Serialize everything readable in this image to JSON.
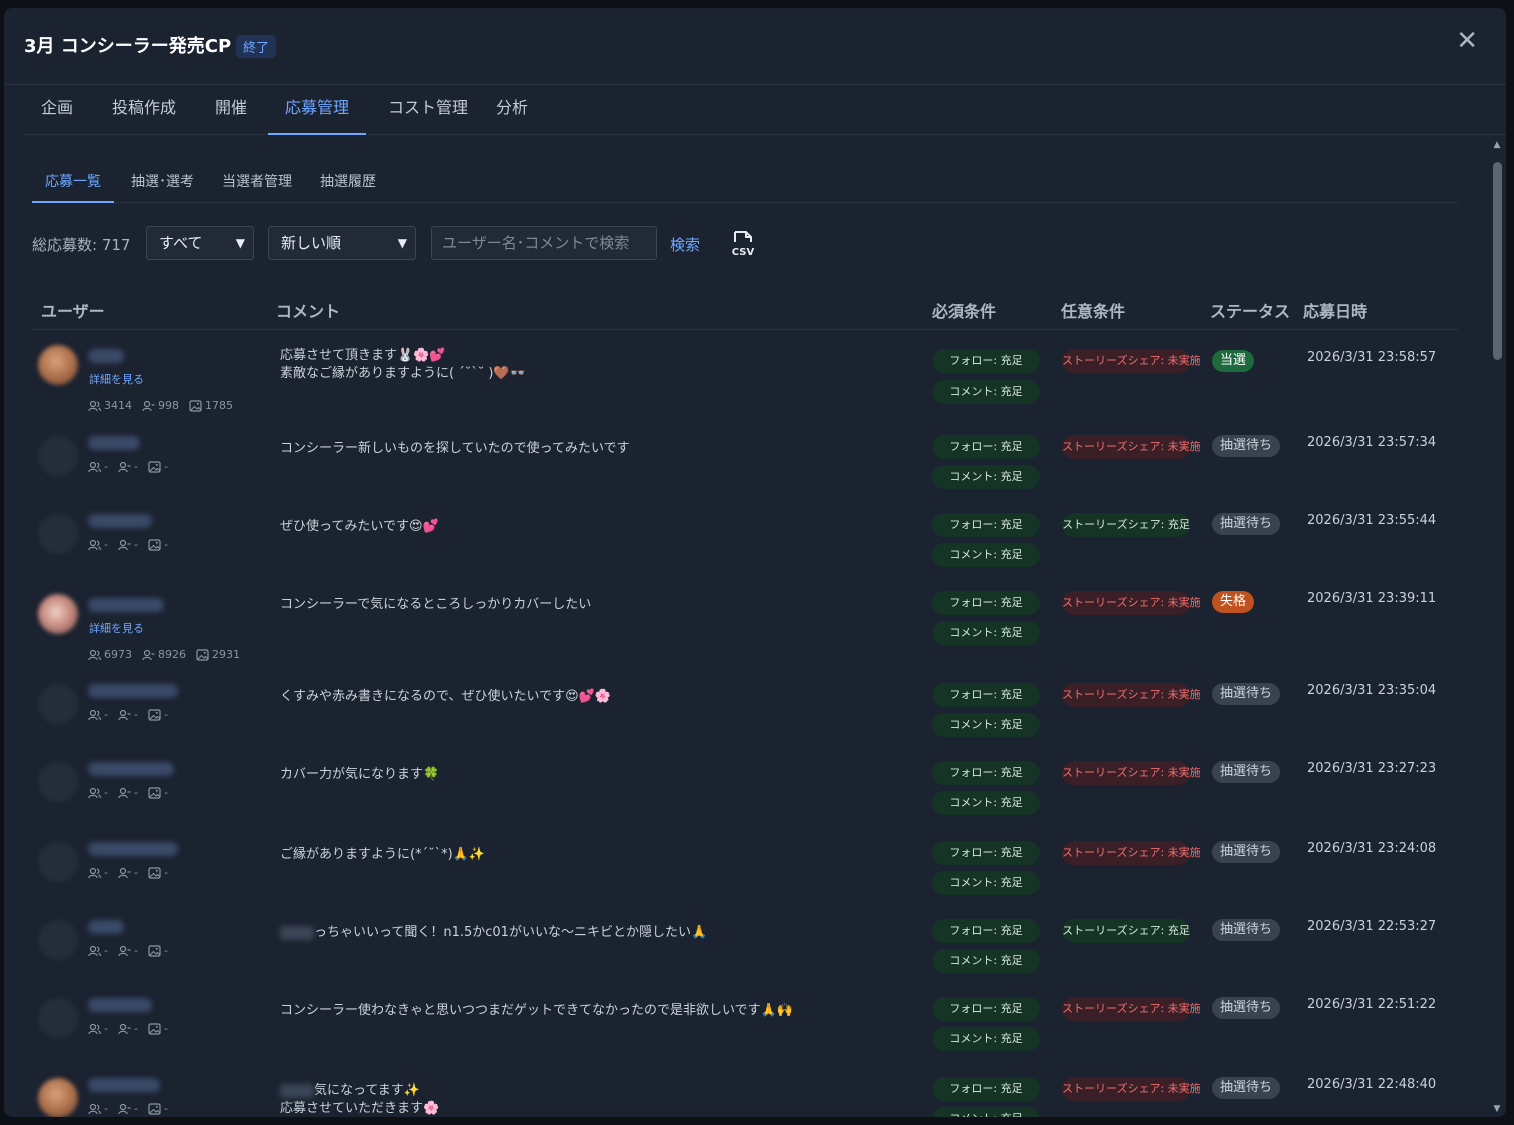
{
  "header": {
    "title": "3月 コンシーラー発売CP",
    "badge": "終了",
    "close": "✕"
  },
  "tabs": [
    "企画",
    "投稿作成",
    "開催",
    "応募管理",
    "コスト管理",
    "分析"
  ],
  "subtabs": [
    "応募一覧",
    "抽選･選考",
    "当選者管理",
    "抽選履歴"
  ],
  "toolbar": {
    "total": "総応募数: 717",
    "filter": "すべて",
    "sort": "新しい順",
    "search_placeholder": "ユーザー名･コメントで検索",
    "search_button": "検索",
    "csv_label": "CSV"
  },
  "columns": [
    "ユーザー",
    "コメント",
    "必須条件",
    "任意条件",
    "ステータス",
    "応募日時"
  ],
  "labels": {
    "detail": "詳細を見る",
    "dash": "-"
  },
  "rows": [
    {
      "stats": [
        "3414",
        "998",
        "1785"
      ],
      "comment": [
        "応募させて頂きます🐰🌸💕",
        "素敵なご縁がありますように( ´˘`˘ )🤎👓"
      ],
      "req": [
        "フォロー: 充足",
        "コメント: 充足"
      ],
      "opt": "ストーリーズシェア: 未実施",
      "status": "当選",
      "date": "2026/3/31 23:58:57"
    },
    {
      "stats": null,
      "comment": [
        "コンシーラー新しいものを探していたので使ってみたいです"
      ],
      "req": [
        "フォロー: 充足",
        "コメント: 充足"
      ],
      "opt": "ストーリーズシェア: 未実施",
      "status": "抽選待ち",
      "date": "2026/3/31 23:57:34"
    },
    {
      "stats": null,
      "comment": [
        "ぜひ使ってみたいです😍💕"
      ],
      "req": [
        "フォロー: 充足",
        "コメント: 充足"
      ],
      "opt": "ストーリーズシェア: 充足",
      "status": "抽選待ち",
      "date": "2026/3/31 23:55:44"
    },
    {
      "stats": [
        "6973",
        "8926",
        "2931"
      ],
      "comment": [
        "コンシーラーで気になるところしっかりカバーしたい"
      ],
      "req": [
        "フォロー: 充足",
        "コメント: 充足"
      ],
      "opt": "ストーリーズシェア: 未実施",
      "status": "失格",
      "date": "2026/3/31 23:39:11"
    },
    {
      "stats": null,
      "comment": [
        "くすみや赤み書きになるので、ぜひ使いたいです😍💕🌸"
      ],
      "req": [
        "フォロー: 充足",
        "コメント: 充足"
      ],
      "opt": "ストーリーズシェア: 未実施",
      "status": "抽選待ち",
      "date": "2026/3/31 23:35:04"
    },
    {
      "stats": null,
      "comment": [
        "カバー力が気になります🍀"
      ],
      "req": [
        "フォロー: 充足",
        "コメント: 充足"
      ],
      "opt": "ストーリーズシェア: 未実施",
      "status": "抽選待ち",
      "date": "2026/3/31 23:27:23"
    },
    {
      "stats": null,
      "comment": [
        "ご縁がありますように(*´˘`*)🙏✨"
      ],
      "req": [
        "フォロー: 充足",
        "コメント: 充足"
      ],
      "opt": "ストーリーズシェア: 未実施",
      "status": "抽選待ち",
      "date": "2026/3/31 23:24:08"
    },
    {
      "stats": null,
      "comment": [
        "っちゃいいって聞く！n1.5かc01がいいな〜ニキビとか隠したい🙏"
      ],
      "req": [
        "フォロー: 充足",
        "コメント: 充足"
      ],
      "opt": "ストーリーズシェア: 充足",
      "status": "抽選待ち",
      "date": "2026/3/31 22:53:27"
    },
    {
      "stats": null,
      "comment": [
        "コンシーラー使わなきゃと思いつつまだゲットできてなかったので是非欲しいです🙏🙌"
      ],
      "req": [
        "フォロー: 充足",
        "コメント: 充足"
      ],
      "opt": "ストーリーズシェア: 未実施",
      "status": "抽選待ち",
      "date": "2026/3/31 22:51:22"
    },
    {
      "stats": null,
      "comment": [
        "気になってます✨",
        "応募させていただきます🌸"
      ],
      "req": [
        "フォロー: 充足",
        "コメント: 充足"
      ],
      "opt": "ストーリーズシェア: 未実施",
      "status": "抽選待ち",
      "date": "2026/3/31 22:48:40"
    }
  ],
  "colors": {
    "accent": "#6fa7ff",
    "ok_bg": "#153426",
    "ng_text": "#ef6f6f",
    "win": "#1d6b3c",
    "lose": "#c0521f"
  }
}
